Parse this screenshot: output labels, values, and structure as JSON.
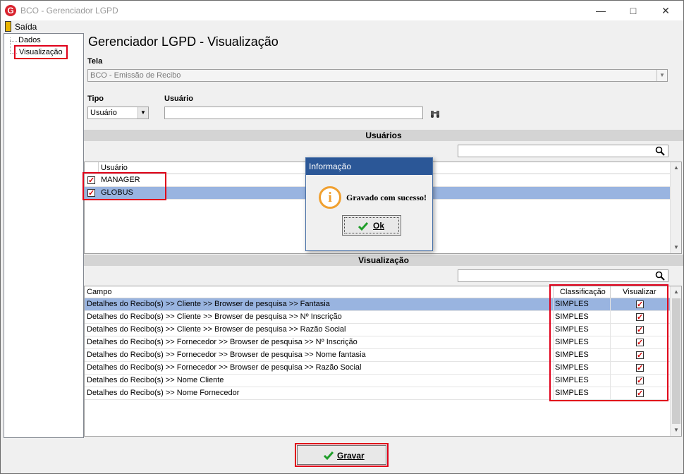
{
  "window": {
    "app_icon_letter": "G",
    "title": "BCO - Gerenciador LGPD"
  },
  "menu": {
    "exit_label": "Saída"
  },
  "tree": {
    "items": [
      {
        "label": "Dados"
      },
      {
        "label": "Visualização"
      }
    ]
  },
  "header": {
    "title": "Gerenciador LGPD - Visualização"
  },
  "form": {
    "tela_label": "Tela",
    "tela_value": "BCO - Emissão de Recibo",
    "tipo_label": "Tipo",
    "tipo_value": "Usuário",
    "usuario_label": "Usuário",
    "usuario_value": ""
  },
  "users_section": {
    "title": "Usuários",
    "column": "Usuário",
    "rows": [
      {
        "name": "MANAGER",
        "checked": true
      },
      {
        "name": "GLOBUS",
        "checked": true
      }
    ]
  },
  "visual_section": {
    "title": "Visualização",
    "columns": {
      "campo": "Campo",
      "classificacao": "Classificação",
      "visualizar": "Visualizar"
    },
    "rows": [
      {
        "campo": "Detalhes do Recibo(s) >> Cliente >> Browser de pesquisa >> Fantasia",
        "classificacao": "SIMPLES",
        "visualizar": true
      },
      {
        "campo": "Detalhes do Recibo(s) >> Cliente >> Browser de pesquisa >> Nº Inscrição",
        "classificacao": "SIMPLES",
        "visualizar": true
      },
      {
        "campo": "Detalhes do Recibo(s) >> Cliente >> Browser de pesquisa >> Razão Social",
        "classificacao": "SIMPLES",
        "visualizar": true
      },
      {
        "campo": "Detalhes do Recibo(s) >> Fornecedor >> Browser de pesquisa >> Nº Inscrição",
        "classificacao": "SIMPLES",
        "visualizar": true
      },
      {
        "campo": "Detalhes do Recibo(s) >> Fornecedor >> Browser de pesquisa >> Nome fantasia",
        "classificacao": "SIMPLES",
        "visualizar": true
      },
      {
        "campo": "Detalhes do Recibo(s) >> Fornecedor >> Browser de pesquisa >> Razão Social",
        "classificacao": "SIMPLES",
        "visualizar": true
      },
      {
        "campo": "Detalhes do Recibo(s) >> Nome Cliente",
        "classificacao": "SIMPLES",
        "visualizar": true
      },
      {
        "campo": "Detalhes do Recibo(s) >> Nome Fornecedor",
        "classificacao": "SIMPLES",
        "visualizar": true
      }
    ]
  },
  "dialog": {
    "title": "Informação",
    "icon_letter": "i",
    "message": "Gravado com sucesso!",
    "ok_label": "Ok"
  },
  "footer": {
    "save_label": "Gravar"
  },
  "colors": {
    "highlight": "#e0001a",
    "selection": "#99b4e0",
    "dialog_title": "#2b5797"
  }
}
